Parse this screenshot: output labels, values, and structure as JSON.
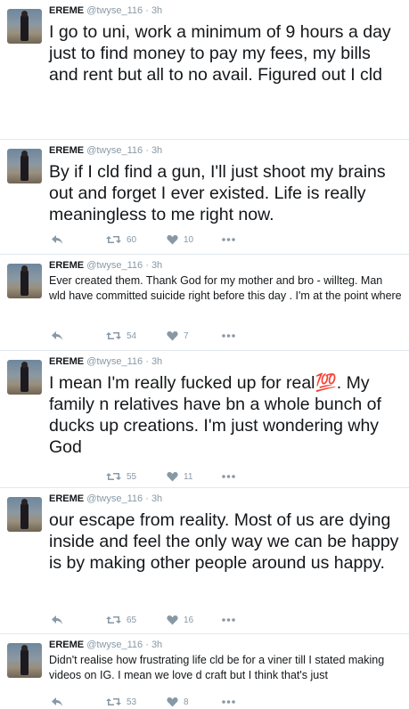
{
  "colors": {
    "muted": "#8899a6",
    "text": "#14171a",
    "divider": "#e1e8ed"
  },
  "tweets": [
    {
      "name": "EREME",
      "handle": "@twyse_116",
      "dot": "·",
      "time": "3h",
      "text": "I go to uni, work a minimum of 9 hours a day just to find money to pay my fees, my bills and rent but all to no avail. Figured out I cld",
      "retweets": "",
      "likes": "",
      "icons": [
        "avatar",
        "reply-icon",
        "retweet-icon",
        "like-icon",
        "more-icon"
      ]
    },
    {
      "name": "EREME",
      "handle": "@twyse_116",
      "dot": "·",
      "time": "3h",
      "text": "By if I cld find a gun, I'll just shoot my brains out and forget I ever existed. Life is really meaningless to me right now.",
      "retweets": "60",
      "likes": "10"
    },
    {
      "name": "EREME",
      "handle": "@twyse_116",
      "dot": "·",
      "time": "3h",
      "text": "Ever created them. Thank God for my mother and bro - willteg. Man wld have committed suicide right before this day . I'm at the point where",
      "retweets": "54",
      "likes": "7"
    },
    {
      "name": "EREME",
      "handle": "@twyse_116",
      "dot": "·",
      "time": "3h",
      "text": "I mean I'm really fucked up for real💯. My family n relatives have bn a whole bunch of ducks up creations. I'm just wondering why God",
      "retweets": "55",
      "likes": "11"
    },
    {
      "name": "EREME",
      "handle": "@twyse_116",
      "dot": "·",
      "time": "3h",
      "text": "our escape from reality. Most of us are dying inside and feel the only way we can be happy is by making other people around us happy.",
      "retweets": "65",
      "likes": "16"
    },
    {
      "name": "EREME",
      "handle": "@twyse_116",
      "dot": "·",
      "time": "3h",
      "text": "Didn't realise how frustrating life cld be for a viner till I stated making videos on IG. I mean we love d craft but I think that's just",
      "retweets": "53",
      "likes": "8"
    }
  ]
}
